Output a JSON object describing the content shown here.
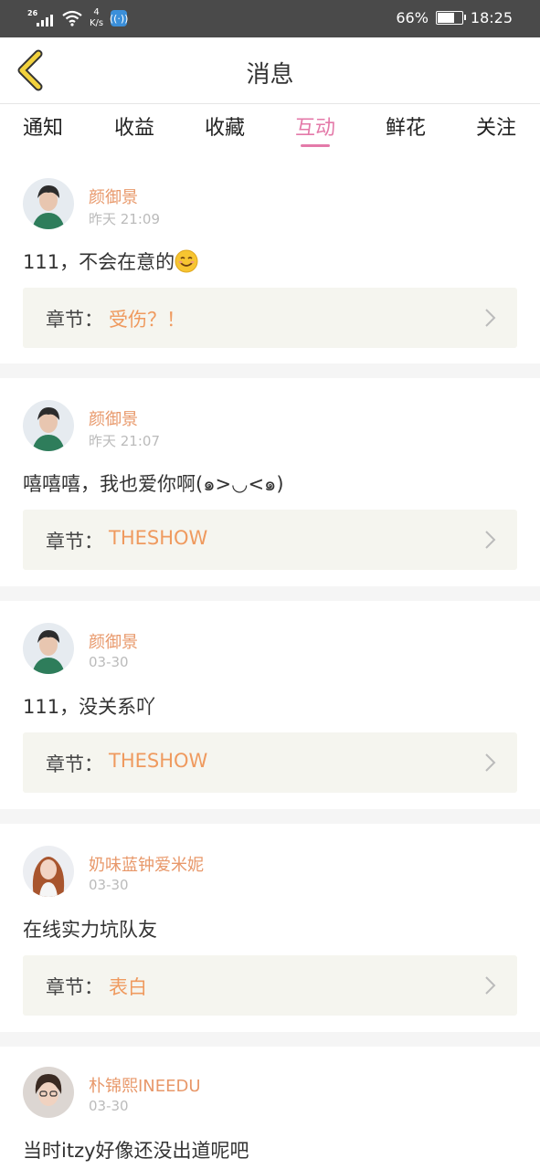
{
  "status_bar": {
    "network": "26",
    "speed_value": "4",
    "speed_unit": "K/s",
    "battery": "66%",
    "time": "18:25"
  },
  "header": {
    "title": "消息"
  },
  "tabs": [
    {
      "label": "通知",
      "active": false
    },
    {
      "label": "收益",
      "active": false
    },
    {
      "label": "收藏",
      "active": false
    },
    {
      "label": "互动",
      "active": true
    },
    {
      "label": "鲜花",
      "active": false
    },
    {
      "label": "关注",
      "active": false
    }
  ],
  "chapter_prefix": "章节：",
  "messages": [
    {
      "user": "颜御景",
      "time": "昨天 21:09",
      "text": "111，不会在意的",
      "chapter": "受伤？！"
    },
    {
      "user": "颜御景",
      "time": "昨天 21:07",
      "text": "嘻嘻嘻，我也爱你啊(๑>◡<๑)",
      "chapter": "THESHOW"
    },
    {
      "user": "颜御景",
      "time": "03-30",
      "text": "111，没关系吖",
      "chapter": "THESHOW"
    },
    {
      "user": "奶味蓝钟爱米妮",
      "time": "03-30",
      "text": "在线实力坑队友",
      "chapter": "表白"
    },
    {
      "user": "朴锦熙INEEDU",
      "time": "03-30",
      "text": "当时itzy好像还没出道呢吧"
    }
  ],
  "colors": {
    "accent_pink": "#e47aa9",
    "username_orange": "#e8986a",
    "chapter_orange": "#ef9a5f",
    "status_bar_bg": "#4a4a4a",
    "back_arrow_yellow": "#f2d23d"
  }
}
